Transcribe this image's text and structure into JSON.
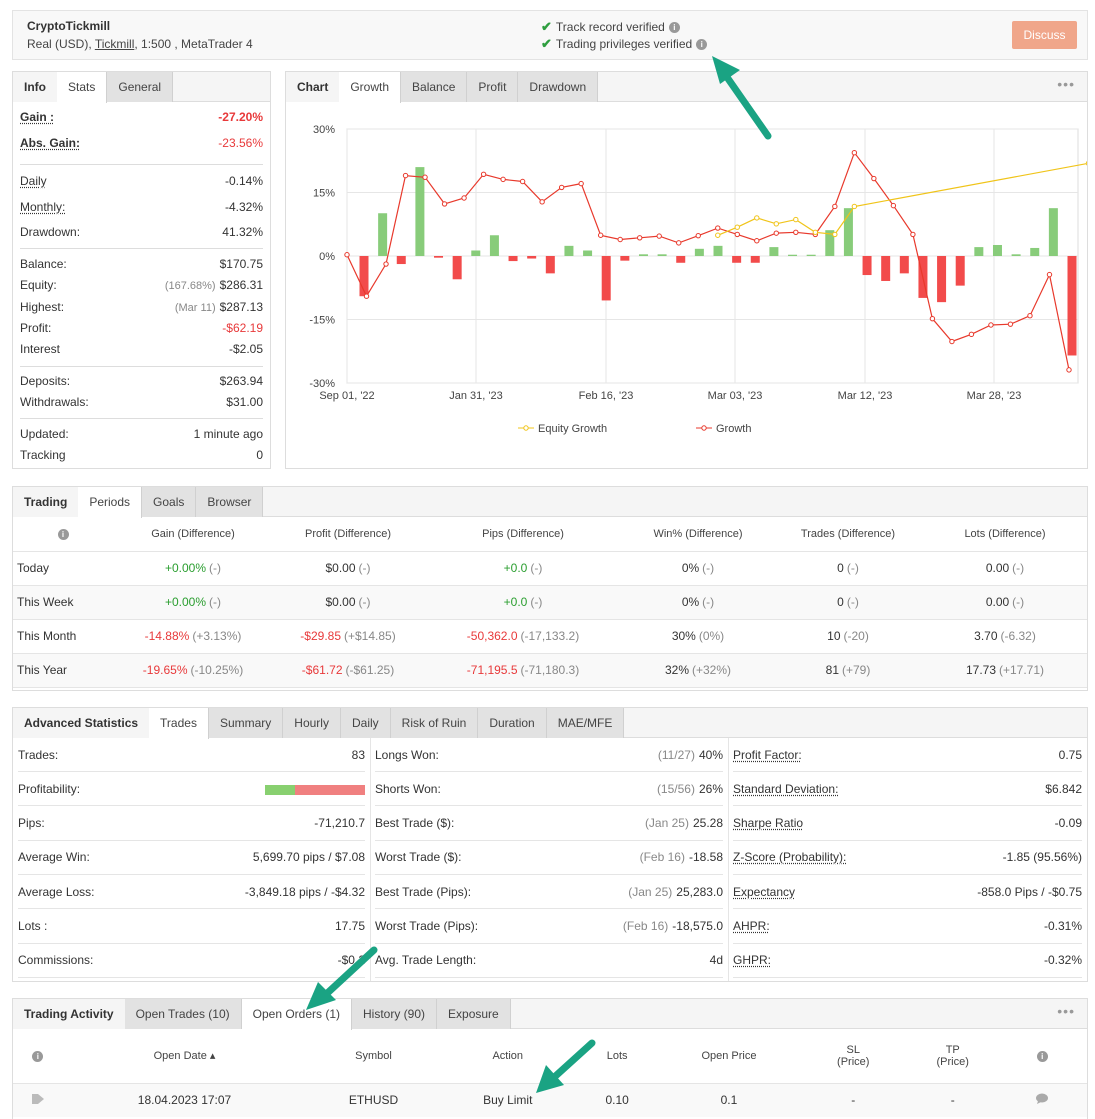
{
  "header": {
    "account_name": "CryptoTickmill",
    "account_prefix": "Real (USD),",
    "broker": "Tickmill",
    "account_suffix": ", 1:500 , MetaTrader 4",
    "verified_1": "Track record verified",
    "verified_2": "Trading privileges verified",
    "discuss_label": "Discuss"
  },
  "info_panel": {
    "tabs": [
      "Info",
      "Stats",
      "General"
    ],
    "rows": [
      {
        "label": "Gain :",
        "value": "-27.20%"
      },
      {
        "label": "Abs. Gain:",
        "value": "-23.56%"
      },
      {
        "label": "Daily",
        "value": "-0.14%"
      },
      {
        "label": "Monthly:",
        "value": "-4.32%"
      },
      {
        "label": "Drawdown:",
        "value": "41.32%"
      },
      {
        "label": "Balance:",
        "value": "$170.75"
      },
      {
        "label": "Equity:",
        "note": "(167.68%)",
        "value": "$286.31"
      },
      {
        "label": "Highest:",
        "note": "(Mar 11)",
        "value": "$287.13"
      },
      {
        "label": "Profit:",
        "value": "-$62.19"
      },
      {
        "label": "Interest",
        "value": "-$2.05"
      },
      {
        "label": "Deposits:",
        "value": "$263.94"
      },
      {
        "label": "Withdrawals:",
        "value": "$31.00"
      },
      {
        "label": "Updated:",
        "value": "1 minute ago"
      },
      {
        "label": "Tracking",
        "value": "0"
      }
    ]
  },
  "chart_panel": {
    "tabs": [
      "Chart",
      "Growth",
      "Balance",
      "Profit",
      "Drawdown"
    ],
    "more": "•••"
  },
  "chart_data": {
    "type": "bar",
    "x_tick_labels": [
      "Sep 01, '22",
      "Jan 31, '23",
      "Feb 16, '23",
      "Mar 03, '23",
      "Mar 12, '23",
      "Mar 28, '23"
    ],
    "y_tick_labels": [
      "30%",
      "15%",
      "0%",
      "-15%",
      "-30%"
    ],
    "ylim": [
      -30,
      30
    ],
    "legend": [
      "Equity Growth",
      "Growth"
    ],
    "bars": [
      -9.5,
      10.1,
      -1.9,
      21.0,
      -0.4,
      -5.5,
      1.3,
      4.9,
      -1.2,
      -0.6,
      -4.1,
      2.4,
      1.3,
      -10.5,
      -1.1,
      0.4,
      0.4,
      -1.6,
      1.7,
      2.4,
      -1.6,
      -1.6,
      2.1,
      0.3,
      0.3,
      6.1,
      11.3,
      -4.5,
      -5.9,
      -4.1,
      -9.9,
      -10.9,
      -7.0,
      2.1,
      2.6,
      0.4,
      1.9,
      11.3,
      -23.5
    ],
    "growth": [
      0.3,
      -9.5,
      -1.9,
      19.0,
      18.6,
      12.3,
      13.7,
      19.3,
      18.1,
      17.6,
      12.8,
      16.2,
      17.1,
      4.9,
      3.9,
      4.3,
      4.7,
      3.1,
      4.8,
      6.6,
      5.1,
      3.6,
      5.4,
      5.6,
      5.1,
      11.7,
      24.4,
      18.3,
      11.9,
      5.1,
      -14.8,
      -20.2,
      -18.5,
      -16.3,
      -16.1,
      -14.1,
      -4.4,
      -26.9
    ],
    "equity_growth": [
      [
        19,
        4.9
      ],
      [
        20,
        6.8
      ],
      [
        21,
        9.0
      ],
      [
        22,
        7.6
      ],
      [
        23,
        8.6
      ],
      [
        24,
        5.6
      ],
      [
        25,
        5.1
      ],
      [
        26,
        11.7
      ],
      [
        38,
        21.9
      ]
    ]
  },
  "periods": {
    "tabs": [
      "Trading",
      "Periods",
      "Goals",
      "Browser"
    ],
    "columns": [
      "Gain (Difference)",
      "Profit (Difference)",
      "Pips (Difference)",
      "Win% (Difference)",
      "Trades (Difference)",
      "Lots (Difference)"
    ],
    "rows": [
      {
        "label": "Today",
        "cells": [
          [
            "+0.00%",
            "(-)"
          ],
          [
            "$0.00",
            "(-)"
          ],
          [
            "+0.0",
            "(-)"
          ],
          [
            "0%",
            "(-)"
          ],
          [
            "0",
            "(-)"
          ],
          [
            "0.00",
            "(-)"
          ]
        ]
      },
      {
        "label": "This Week",
        "cells": [
          [
            "+0.00%",
            "(-)"
          ],
          [
            "$0.00",
            "(-)"
          ],
          [
            "+0.0",
            "(-)"
          ],
          [
            "0%",
            "(-)"
          ],
          [
            "0",
            "(-)"
          ],
          [
            "0.00",
            "(-)"
          ]
        ]
      },
      {
        "label": "This Month",
        "cells": [
          [
            "-14.88%",
            "(+3.13%)"
          ],
          [
            "-$29.85",
            "(+$14.85)"
          ],
          [
            "-50,362.0",
            "(-17,133.2)"
          ],
          [
            "30%",
            "(0%)"
          ],
          [
            "10",
            "(-20)"
          ],
          [
            "3.70",
            "(-6.32)"
          ]
        ]
      },
      {
        "label": "This Year",
        "cells": [
          [
            "-19.65%",
            "(-10.25%)"
          ],
          [
            "-$61.72",
            "(-$61.25)"
          ],
          [
            "-71,195.5",
            "(-71,180.3)"
          ],
          [
            "32%",
            "(+32%)"
          ],
          [
            "81",
            "(+79)"
          ],
          [
            "17.73",
            "(+17.71)"
          ]
        ]
      }
    ]
  },
  "advanced": {
    "tabs": [
      "Advanced Statistics",
      "Trades",
      "Summary",
      "Hourly",
      "Daily",
      "Risk of Ruin",
      "Duration",
      "MAE/MFE"
    ],
    "col1": [
      {
        "label": "Trades:",
        "value": "83"
      },
      {
        "label": "Profitability:",
        "value": ""
      },
      {
        "label": "Pips:",
        "value": "-71,210.7"
      },
      {
        "label": "Average Win:",
        "value": "5,699.70 pips / $7.08"
      },
      {
        "label": "Average Loss:",
        "value": "-3,849.18 pips / -$4.32"
      },
      {
        "label": "Lots :",
        "value": "17.75"
      },
      {
        "label": "Commissions:",
        "value": "-$0.2"
      }
    ],
    "profitability_fraction": 0.3,
    "col2": [
      {
        "label": "Longs Won:",
        "note": "(11/27)",
        "value": "40%"
      },
      {
        "label": "Shorts Won:",
        "note": "(15/56)",
        "value": "26%"
      },
      {
        "label": "Best Trade ($):",
        "note": "(Jan 25)",
        "value": "25.28"
      },
      {
        "label": "Worst Trade ($):",
        "note": "(Feb 16)",
        "value": "-18.58"
      },
      {
        "label": "Best Trade (Pips):",
        "note": "(Jan 25)",
        "value": "25,283.0"
      },
      {
        "label": "Worst Trade (Pips):",
        "note": "(Feb 16)",
        "value": "-18,575.0"
      },
      {
        "label": "Avg. Trade Length:",
        "note": "",
        "value": "4d"
      }
    ],
    "col3": [
      {
        "label": "Profit Factor:",
        "value": "0.75"
      },
      {
        "label": "Standard Deviation:",
        "value": "$6.842"
      },
      {
        "label": "Sharpe Ratio",
        "value": "-0.09"
      },
      {
        "label": "Z-Score (Probability):",
        "value": "-1.85 (95.56%)"
      },
      {
        "label": "Expectancy",
        "value": "-858.0 Pips / -$0.75"
      },
      {
        "label": "AHPR:",
        "value": "-0.31%"
      },
      {
        "label": "GHPR:",
        "value": "-0.32%"
      }
    ]
  },
  "activity": {
    "tabs": [
      "Trading Activity",
      "Open Trades (10)",
      "Open Orders (1)",
      "History (90)",
      "Exposure"
    ],
    "more": "•••",
    "columns": {
      "open_date": "Open Date ▴",
      "symbol": "Symbol",
      "action": "Action",
      "lots": "Lots",
      "open_price": "Open Price",
      "sl_1": "SL",
      "sl_2": "(Price)",
      "tp_1": "TP",
      "tp_2": "(Price)"
    },
    "row": {
      "open_date": "18.04.2023 17:07",
      "symbol": "ETHUSD",
      "action": "Buy Limit",
      "lots": "0.10",
      "open_price": "0.1",
      "sl": "-",
      "tp": "-"
    }
  },
  "colors": {
    "green": "#2a9e2f",
    "red": "#e8393a",
    "bar_green": "#88cc7a",
    "bar_red": "#f24b4b",
    "equity_line": "#f0c419",
    "growth_line": "#e8392c",
    "arrow": "#1aa383"
  }
}
